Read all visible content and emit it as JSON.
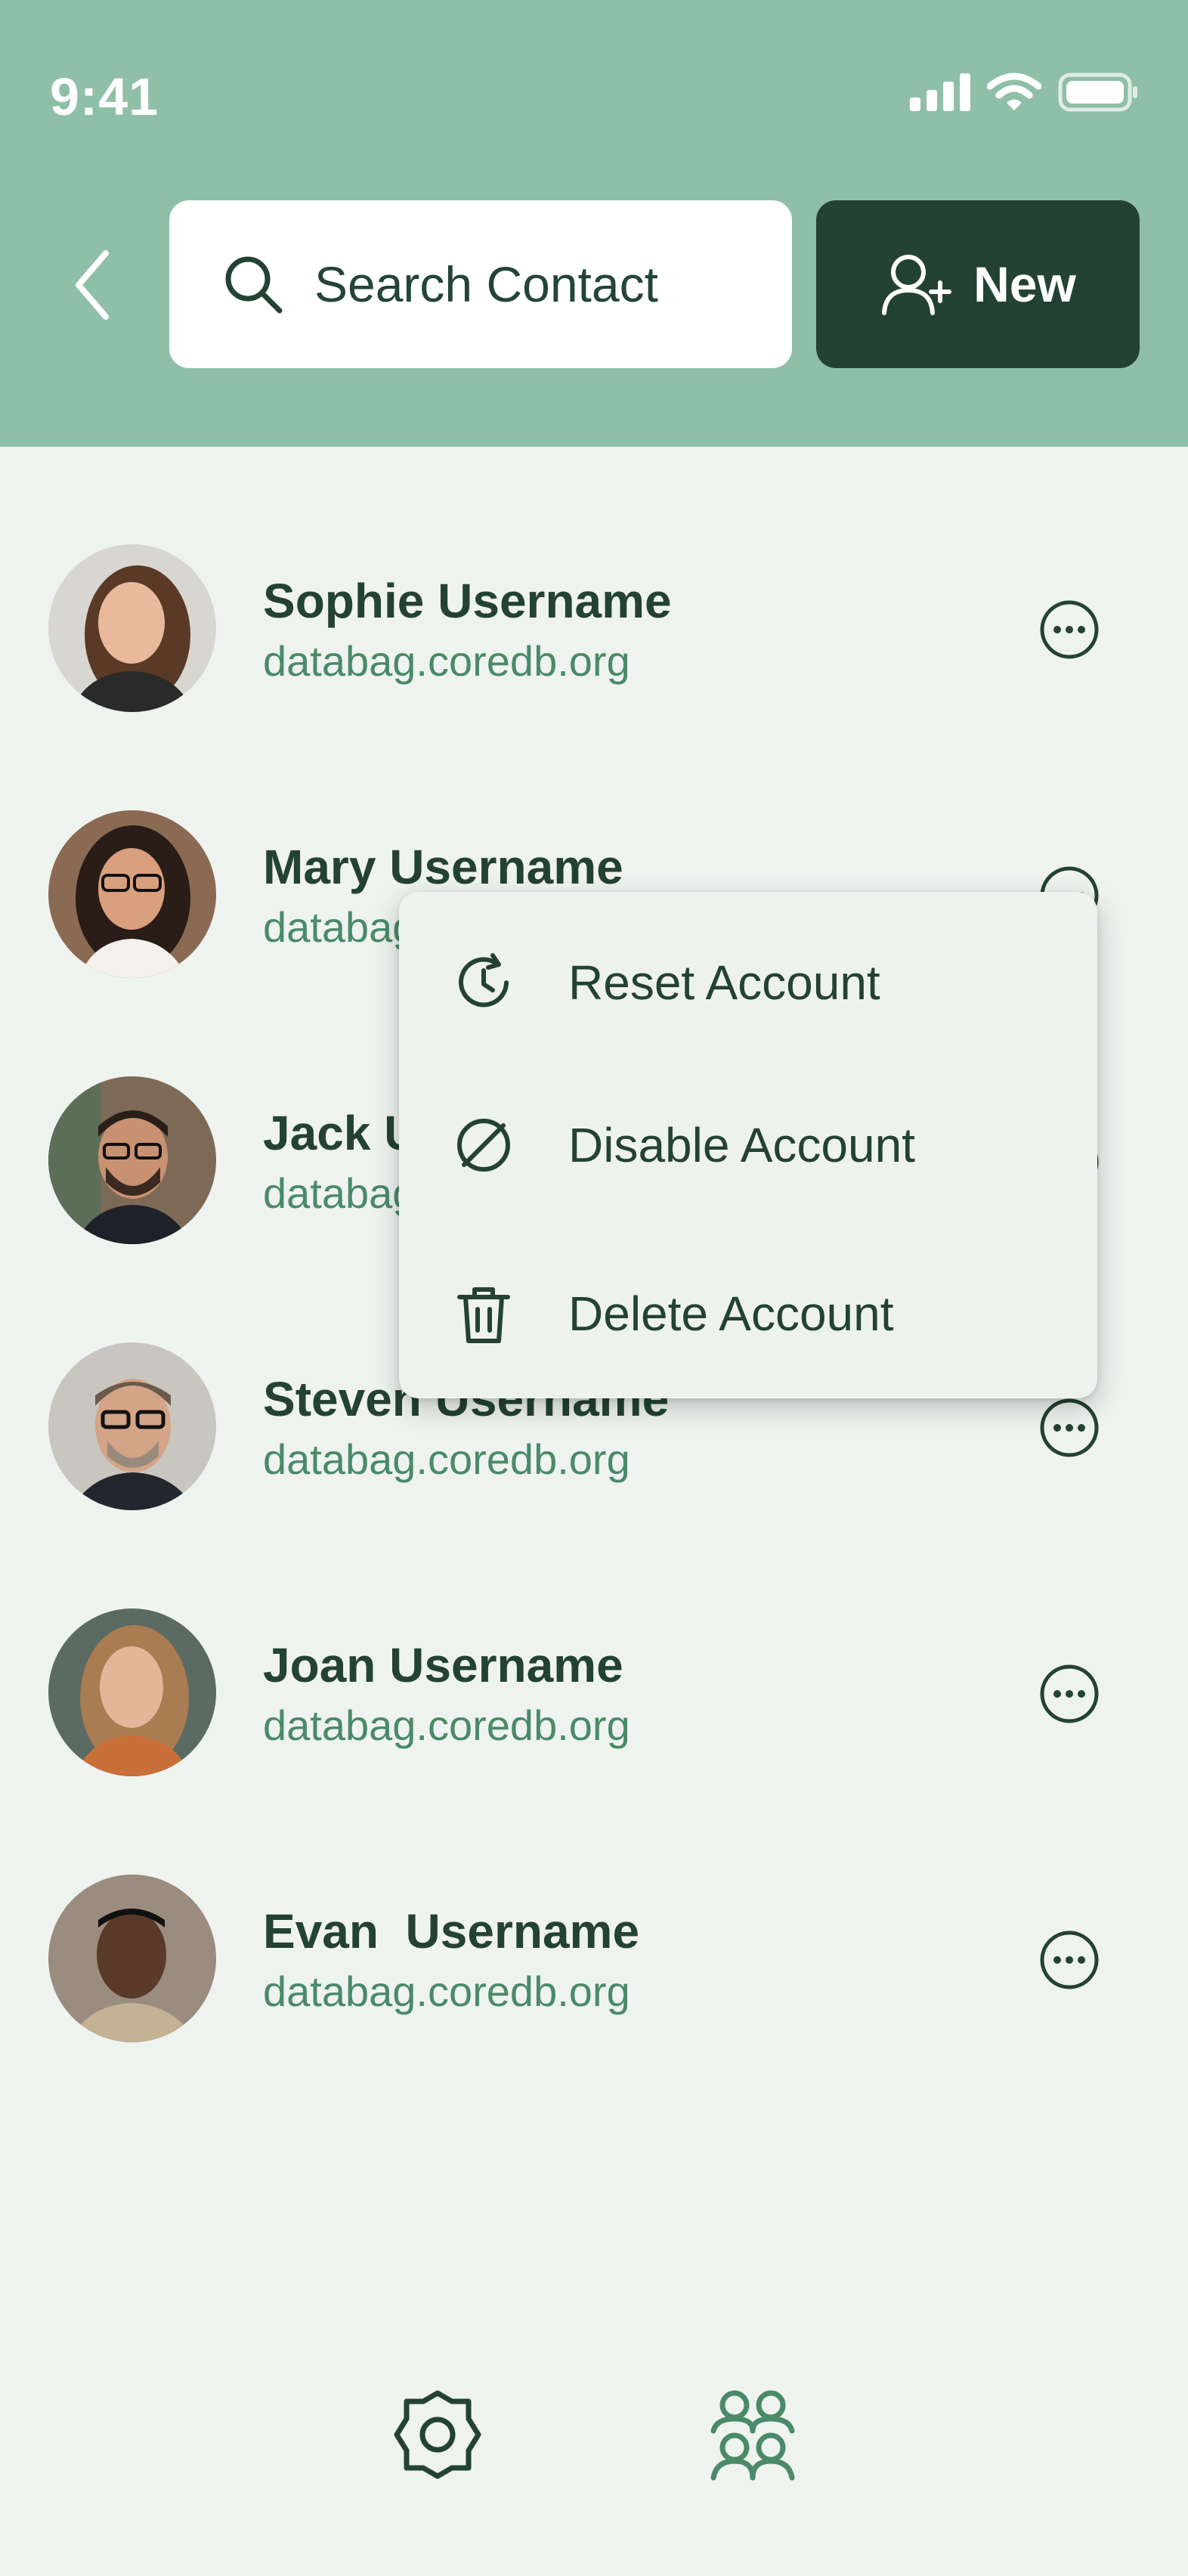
{
  "status_bar": {
    "time": "9:41"
  },
  "header": {
    "back_icon": "chevron-left-icon",
    "search": {
      "placeholder": "Search Contact",
      "value": "",
      "icon": "search-icon"
    },
    "new_button": {
      "label": "New",
      "icon": "add-user-icon"
    }
  },
  "contacts": [
    {
      "name": "Sophie Username",
      "domain": "databag.coredb.org"
    },
    {
      "name": "Mary Username",
      "domain": "databag.coredb.org"
    },
    {
      "name": "Jack Username",
      "domain": "databag.coredb.org"
    },
    {
      "name": "Steven Username",
      "domain": "databag.coredb.org"
    },
    {
      "name": "Joan Username",
      "domain": "databag.coredb.org"
    },
    {
      "name": "Evan  Username",
      "domain": "databag.coredb.org"
    }
  ],
  "context_menu": {
    "items": [
      {
        "label": "Reset Account",
        "icon": "reset-clock-icon"
      },
      {
        "label": "Disable Account",
        "icon": "disable-icon"
      },
      {
        "label": "Delete Account",
        "icon": "trash-icon"
      }
    ]
  },
  "bottom_nav": {
    "settings_icon": "gear-icon",
    "contacts_icon": "contacts-group-icon"
  },
  "colors": {
    "header": "#8fbfa6",
    "primary": "#234233",
    "accent": "#4a8a68",
    "background": "#eff3f0"
  }
}
